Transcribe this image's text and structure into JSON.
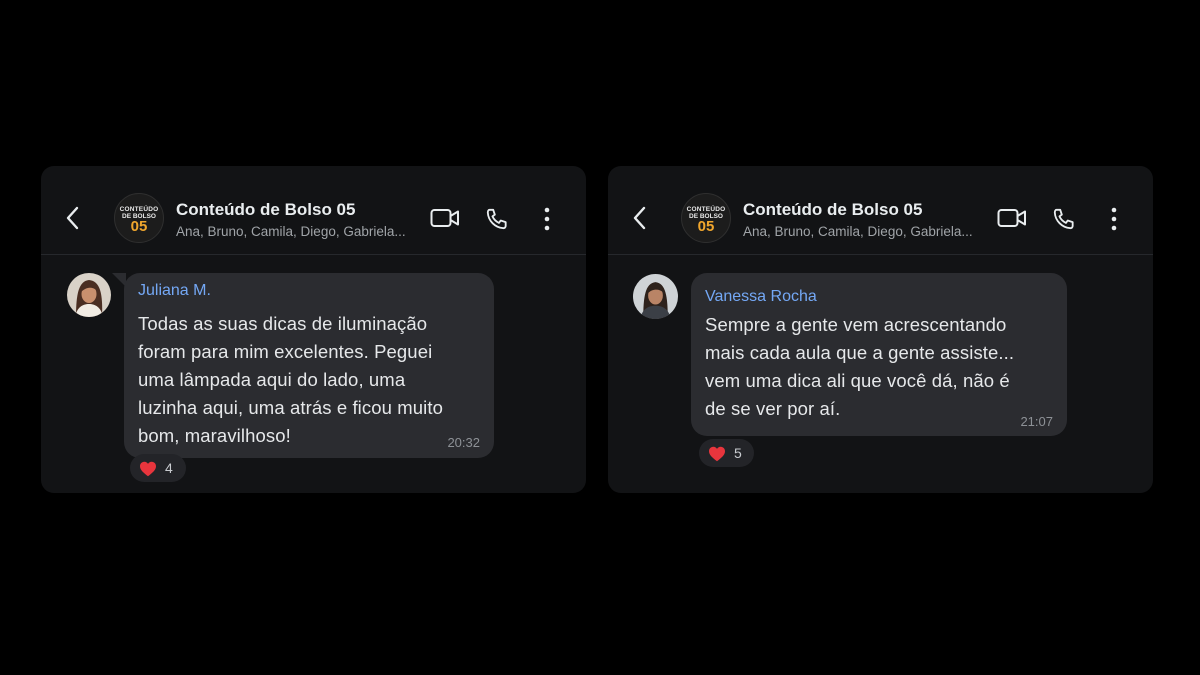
{
  "colors": {
    "page_background": "#000000",
    "card_background": "#121315",
    "bubble_background": "#2b2c30",
    "sender_name": "#74a8f5",
    "badge_number": "#f0a62d"
  },
  "chats": [
    {
      "header": {
        "back_icon": "chevron-left-icon",
        "avatar": {
          "line1": "CONTEÚDO",
          "line2": "DE BOLSO",
          "number": "05"
        },
        "title": "Conteúdo de Bolso 05",
        "members": "Ana, Bruno, Camila, Diego, Gabriela...",
        "video_icon": "video-call-icon",
        "call_icon": "phone-icon",
        "menu_icon": "more-vertical-icon"
      },
      "message": {
        "sender": "Juliana M.",
        "lines": [
          "Todas as suas dicas de iluminação",
          "foram para mim excelentes. Peguei",
          "uma lâmpada aqui do lado, uma",
          "luzinha aqui, uma atrás e ficou muito",
          "bom, maravilhoso!"
        ],
        "time": "20:32",
        "reaction": {
          "icon": "heart-icon",
          "count": "4"
        }
      }
    },
    {
      "header": {
        "back_icon": "chevron-left-icon",
        "avatar": {
          "line1": "CONTEÚDO",
          "line2": "DE BOLSO",
          "number": "05"
        },
        "title": "Conteúdo de Bolso 05",
        "members": "Ana, Bruno, Camila, Diego, Gabriela...",
        "video_icon": "video-call-icon",
        "call_icon": "phone-icon",
        "menu_icon": "more-vertical-icon"
      },
      "message": {
        "sender": "Vanessa Rocha",
        "lines": [
          "Sempre a gente vem acrescentando",
          "mais cada aula que a gente assiste...",
          "vem uma dica ali que você dá, não é",
          "de se ver por aí."
        ],
        "time": "21:07",
        "reaction": {
          "icon": "heart-icon",
          "count": "5"
        }
      }
    }
  ]
}
